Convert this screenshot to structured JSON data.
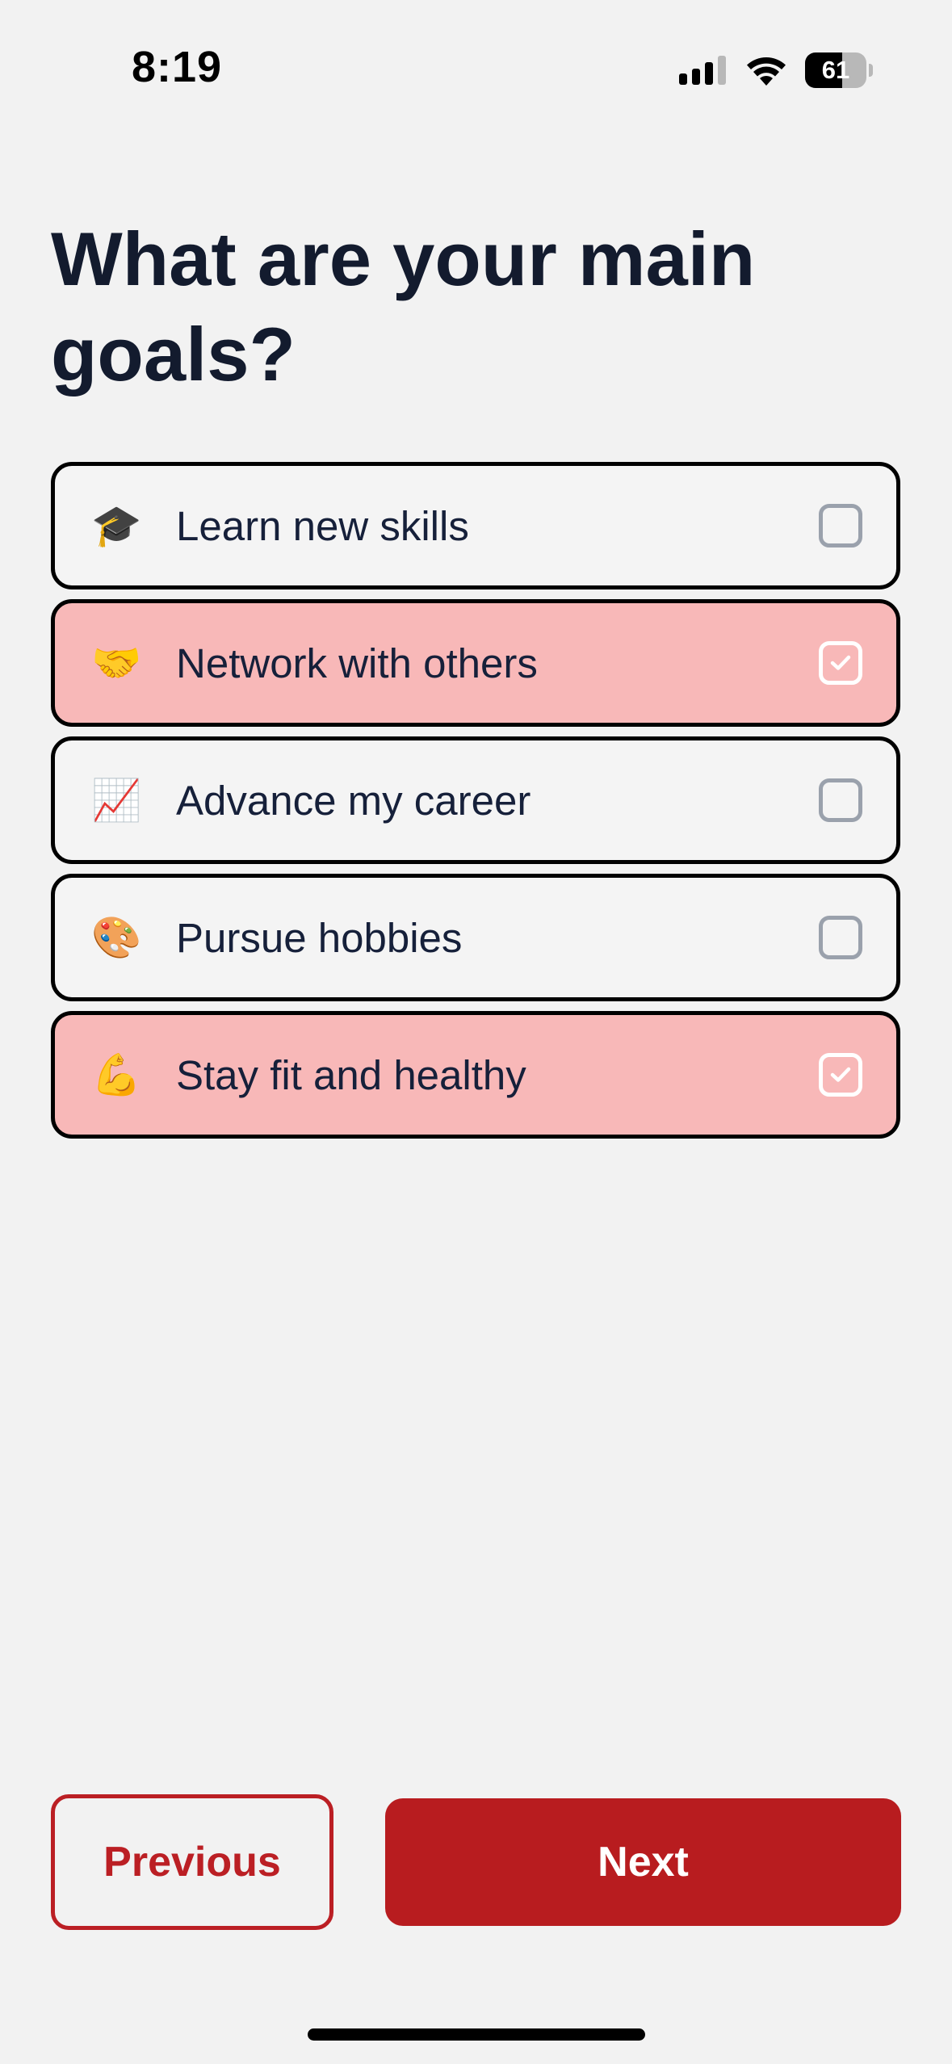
{
  "status_bar": {
    "time": "8:19",
    "battery_percent": "61",
    "battery_level": 0.61,
    "icons": [
      "signal-icon",
      "wifi-icon",
      "battery-icon"
    ]
  },
  "title": "What are your main goals?",
  "options": [
    {
      "emoji": "🎓",
      "icon": "graduation-cap-icon",
      "label": "Learn new skills",
      "selected": false
    },
    {
      "emoji": "🤝",
      "icon": "handshake-icon",
      "label": "Network with others",
      "selected": true
    },
    {
      "emoji": "📈",
      "icon": "chart-increasing-icon",
      "label": "Advance my career",
      "selected": false
    },
    {
      "emoji": "🎨",
      "icon": "artist-palette-icon",
      "label": "Pursue hobbies",
      "selected": false
    },
    {
      "emoji": "💪",
      "icon": "flexed-biceps-icon",
      "label": "Stay fit and healthy",
      "selected": true
    }
  ],
  "buttons": {
    "previous_label": "Previous",
    "next_label": "Next"
  },
  "colors": {
    "accent": "#b81c1f",
    "selected_background": "#f8b8b8",
    "page_background": "#f2f2f2",
    "text": "#131b2e"
  }
}
